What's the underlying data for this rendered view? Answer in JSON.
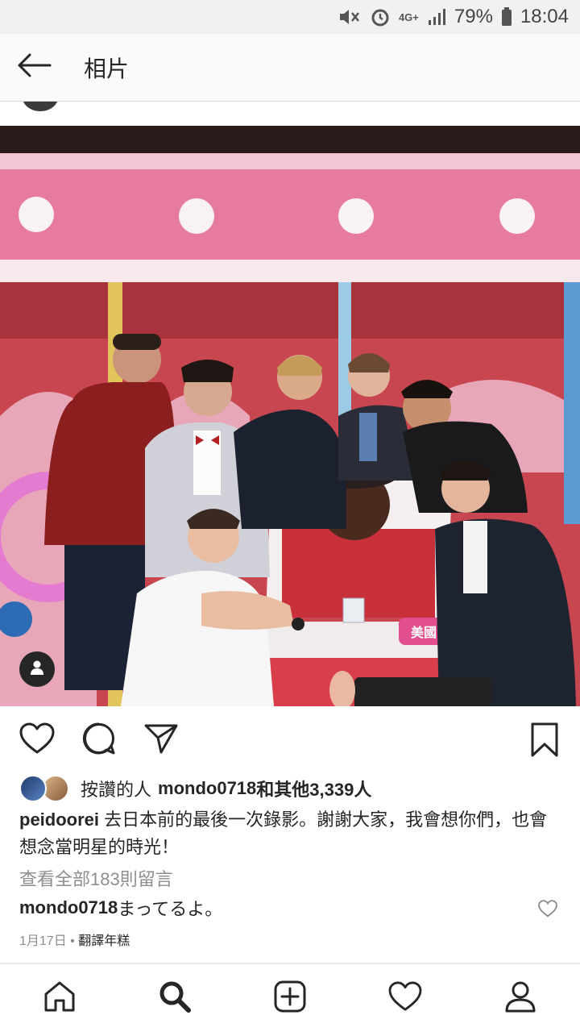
{
  "status": {
    "network": "4G+",
    "battery": "79%",
    "time": "18:04"
  },
  "header": {
    "title": "相片"
  },
  "photo": {
    "sign_text": "美國 杜力"
  },
  "post": {
    "likes_prefix": "按讚的人",
    "likes_user": "mondo0718",
    "likes_suffix": "和其他3,339人",
    "caption_user": "peidoorei",
    "caption_text": " 去日本前的最後一次錄影。謝謝大家，我會想你們，也會想念當明星的時光！",
    "view_all": "查看全部183則留言",
    "comment_user": "mondo0718",
    "comment_text": " まってるよ。",
    "date": "1月17日",
    "separator": " • ",
    "translate": "翻譯年糕"
  },
  "icons": {
    "back": "arrow-left-icon",
    "like": "heart-icon",
    "comment": "comment-icon",
    "share": "send-icon",
    "save": "bookmark-icon",
    "tag": "person-icon",
    "home": "home-icon",
    "search": "search-icon",
    "add": "add-post-icon",
    "activity": "heart-icon",
    "profile": "profile-icon"
  },
  "colors": {
    "stage_pink": "#e77aa0",
    "text": "#262626",
    "muted": "#8e8e8e"
  }
}
